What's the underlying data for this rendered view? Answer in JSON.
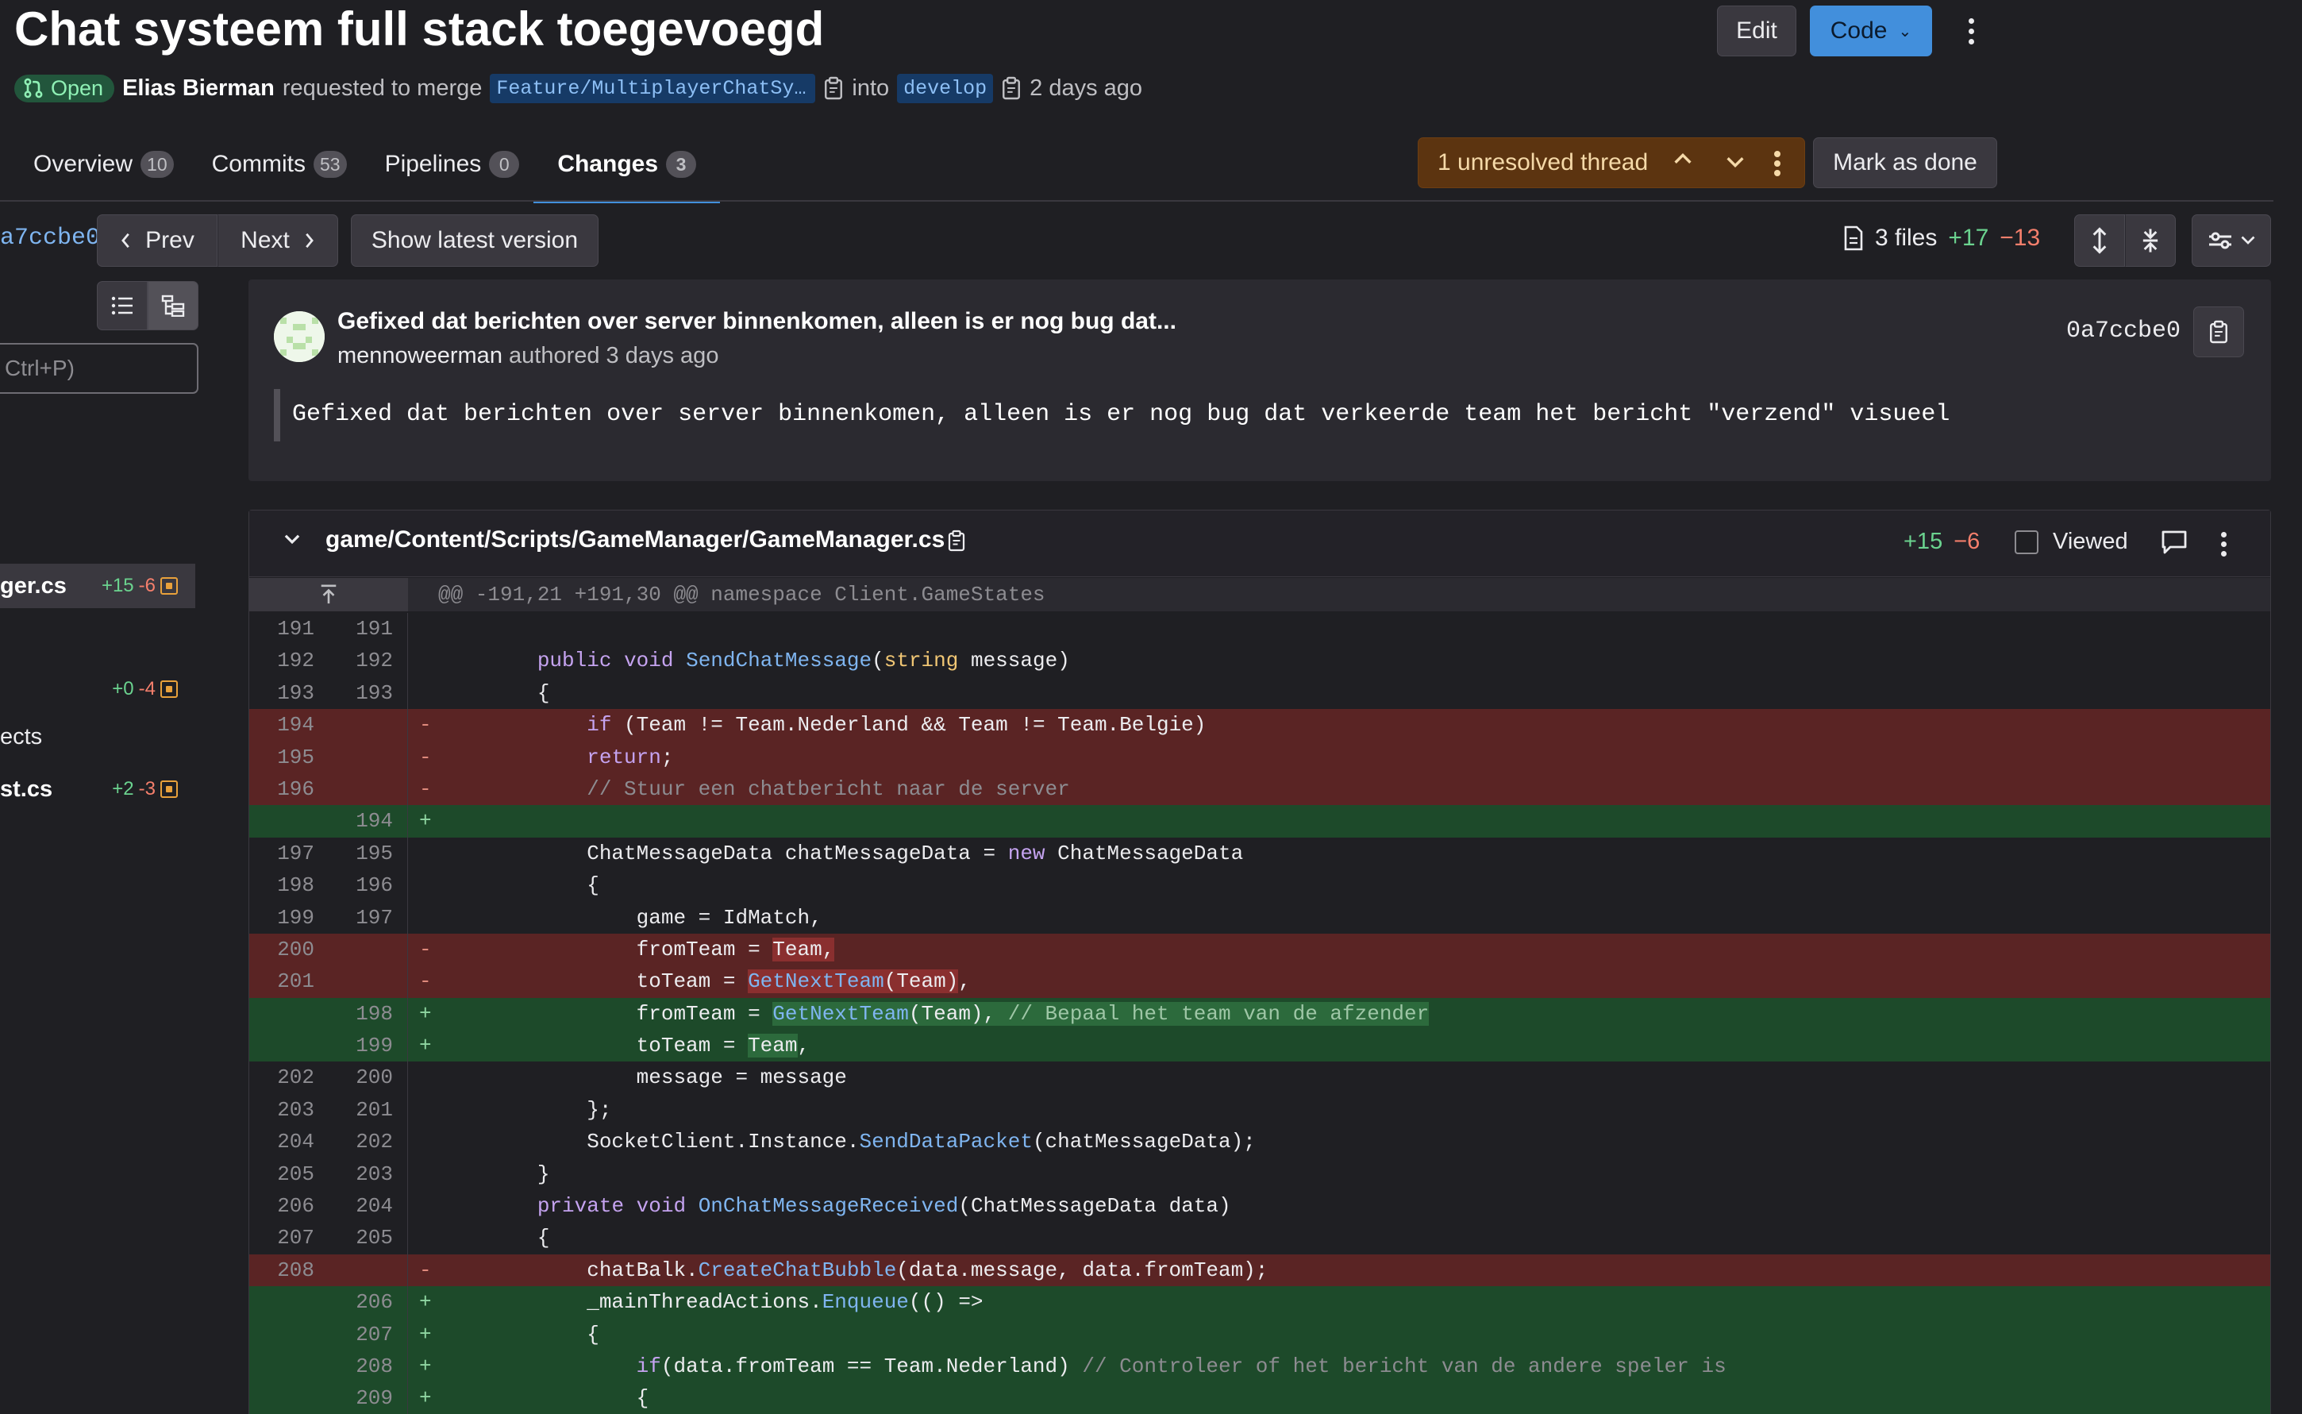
{
  "mr": {
    "title": "Chat systeem full stack toegevoegd",
    "status": "Open",
    "author": "Elias Bierman",
    "requested_text": "requested to merge",
    "source_branch": "Feature/MultiplayerChatSys…",
    "into_text": "into",
    "target_branch": "develop",
    "time": "2 days ago"
  },
  "actions": {
    "edit": "Edit",
    "code": "Code"
  },
  "tabs": [
    {
      "label": "Overview",
      "count": "10"
    },
    {
      "label": "Commits",
      "count": "53"
    },
    {
      "label": "Pipelines",
      "count": "0"
    },
    {
      "label": "Changes",
      "count": "3"
    }
  ],
  "threads": {
    "label": "1 unresolved thread",
    "mark_done": "Mark as done"
  },
  "version_bar": {
    "commit_sha": "a7ccbe0",
    "prev": "Prev",
    "next": "Next",
    "show_latest": "Show latest version",
    "files": "3 files",
    "added": "+17",
    "removed": "−13"
  },
  "sidebar": {
    "search_placeholder": "Ctrl+P)",
    "files": [
      {
        "name": "ger.cs",
        "added": "+15",
        "removed": "-6"
      },
      {
        "name": "",
        "added": "+0",
        "removed": "-4"
      },
      {
        "name": "ects",
        "added": "",
        "removed": ""
      },
      {
        "name": "st.cs",
        "added": "+2",
        "removed": "-3"
      }
    ]
  },
  "commit": {
    "title": "Gefixed dat berichten over server binnenkomen, alleen is er nog bug dat...",
    "author": "mennoweerman",
    "authored": "authored 3 days ago",
    "sha": "0a7ccbe0",
    "description": "Gefixed dat berichten over server binnenkomen, alleen is er nog bug dat verkeerde team het bericht \"verzend\" visueel"
  },
  "diff": {
    "path": "game/Content/Scripts/GameManager/GameManager.cs",
    "added": "+15",
    "removed": "−6",
    "viewed_label": "Viewed",
    "hunk": "@@ -191,21 +191,30 @@ namespace Client.GameStates",
    "lines": [
      {
        "type": "ctx",
        "old": "191",
        "new": "191",
        "sign": "",
        "html": ""
      },
      {
        "type": "ctx",
        "old": "192",
        "new": "192",
        "sign": "",
        "html": "        <span class=\"kw\">public</span> <span class=\"kw\">void</span> <span class=\"fn\">SendChatMessage</span>(<span class=\"ty\">string</span> message)"
      },
      {
        "type": "ctx",
        "old": "193",
        "new": "193",
        "sign": "",
        "html": "        {"
      },
      {
        "type": "del",
        "old": "194",
        "new": "",
        "sign": "-",
        "html": "            <span class=\"kw\">if</span> (Team != Team.Nederland &amp;&amp; Team != Team.Belgie)"
      },
      {
        "type": "del",
        "old": "195",
        "new": "",
        "sign": "-",
        "html": "            <span class=\"kw\">return</span>;"
      },
      {
        "type": "del",
        "old": "196",
        "new": "",
        "sign": "-",
        "html": "            <span class=\"cm\">// Stuur een chatbericht naar de server</span>"
      },
      {
        "type": "add",
        "old": "",
        "new": "194",
        "sign": "+",
        "html": ""
      },
      {
        "type": "ctx",
        "old": "197",
        "new": "195",
        "sign": "",
        "html": "            ChatMessageData chatMessageData = <span class=\"kw\">new</span> ChatMessageData"
      },
      {
        "type": "ctx",
        "old": "198",
        "new": "196",
        "sign": "",
        "html": "            {"
      },
      {
        "type": "ctx",
        "old": "199",
        "new": "197",
        "sign": "",
        "html": "                game = IdMatch,"
      },
      {
        "type": "del",
        "old": "200",
        "new": "",
        "sign": "-",
        "html": "                fromTeam = <span class=\"hl-del\">Team,</span>"
      },
      {
        "type": "del",
        "old": "201",
        "new": "",
        "sign": "-",
        "html": "                toTeam = <span class=\"hl-del\"><span class=\"fn\">GetNextTeam</span>(Team)</span>,"
      },
      {
        "type": "add",
        "old": "",
        "new": "198",
        "sign": "+",
        "html": "                fromTeam = <span class=\"hl-add\"><span class=\"fn\">GetNextTeam</span>(Team), <span class=\"cm-add\">// Bepaal het team van de afzender</span></span>"
      },
      {
        "type": "add",
        "old": "",
        "new": "199",
        "sign": "+",
        "html": "                toTeam = <span class=\"hl-add\">Team</span>,"
      },
      {
        "type": "ctx",
        "old": "202",
        "new": "200",
        "sign": "",
        "html": "                message = message"
      },
      {
        "type": "ctx",
        "old": "203",
        "new": "201",
        "sign": "",
        "html": "            };"
      },
      {
        "type": "ctx",
        "old": "204",
        "new": "202",
        "sign": "",
        "html": "            SocketClient.Instance.<span class=\"fn\">SendDataPacket</span>(chatMessageData);"
      },
      {
        "type": "ctx",
        "old": "205",
        "new": "203",
        "sign": "",
        "html": "        }"
      },
      {
        "type": "ctx",
        "old": "206",
        "new": "204",
        "sign": "",
        "html": "        <span class=\"kw\">private</span> <span class=\"kw\">void</span> <span class=\"fn\">OnChatMessageReceived</span>(ChatMessageData data)"
      },
      {
        "type": "ctx",
        "old": "207",
        "new": "205",
        "sign": "",
        "html": "        {"
      },
      {
        "type": "del",
        "old": "208",
        "new": "",
        "sign": "-",
        "html": "            chatBalk.<span class=\"fn\">CreateChatBubble</span>(data.message, data.fromTeam);"
      },
      {
        "type": "add",
        "old": "",
        "new": "206",
        "sign": "+",
        "html": "            _mainThreadActions.<span class=\"fn\">Enqueue</span>(() =&gt;"
      },
      {
        "type": "add",
        "old": "",
        "new": "207",
        "sign": "+",
        "html": "            {"
      },
      {
        "type": "add",
        "old": "",
        "new": "208",
        "sign": "+",
        "html": "                <span class=\"kw\">if</span>(data.fromTeam == Team.Nederland) <span class=\"cm\">// Controleer of het bericht van de andere speler is</span>"
      },
      {
        "type": "add",
        "old": "",
        "new": "209",
        "sign": "+",
        "html": "                {"
      }
    ]
  }
}
